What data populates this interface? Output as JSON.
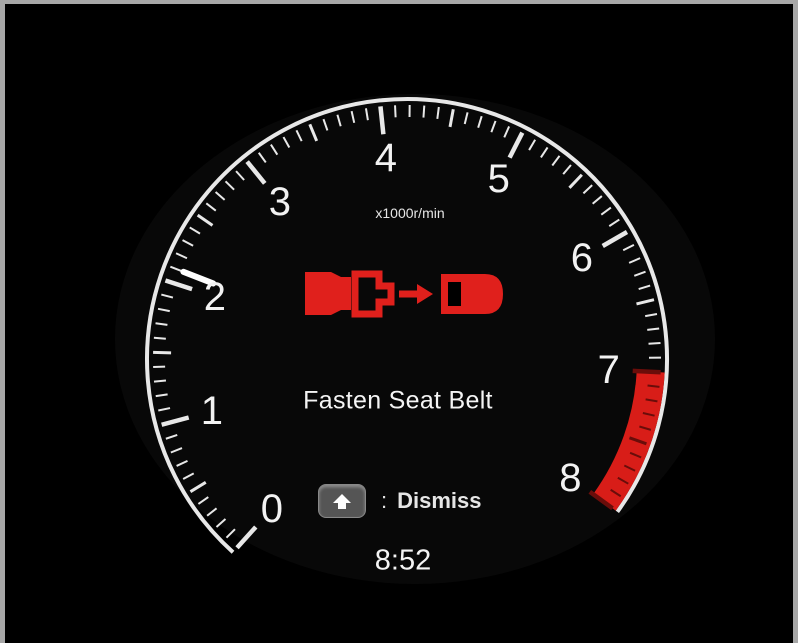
{
  "gauge": {
    "type": "tachometer",
    "scale_labels": [
      "0",
      "1",
      "2",
      "3",
      "4",
      "5",
      "6",
      "7",
      "8"
    ],
    "units": "x1000r/min",
    "value": 2.1,
    "min": 0,
    "max": 8,
    "redline_start": 7,
    "colors": {
      "dial": "#ffffff",
      "redline": "#e0201c",
      "needle": "#ffffff"
    }
  },
  "warning": {
    "icon": "seatbelt-warning-icon",
    "icon_color": "#e0201c",
    "message": "Fasten Seat Belt"
  },
  "dismiss": {
    "button_icon": "up-arrow-icon",
    "separator": ":",
    "label": "Dismiss"
  },
  "clock": {
    "time": "8:52"
  }
}
